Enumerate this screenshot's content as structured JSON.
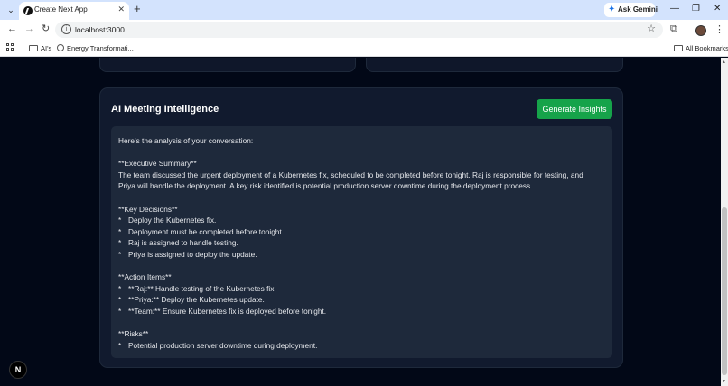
{
  "browser": {
    "tab_title": "Create Next App",
    "ask_gemini": "Ask Gemini",
    "url": "localhost:3000",
    "bookmarks": [
      "AI's",
      "Energy Transformati..."
    ],
    "all_bookmarks": "All Bookmarks"
  },
  "card": {
    "title": "AI Meeting Intelligence",
    "button_label": "Generate Insights",
    "lines": [
      "Here's the analysis of your conversation:",
      "",
      "**Executive Summary**",
      "The team discussed the urgent deployment of a Kubernetes fix, scheduled to be completed before tonight. Raj is responsible for testing, and",
      "Priya will handle the deployment. A key risk identified is potential production server downtime during the deployment process.",
      "",
      "**Key Decisions**",
      "Deploy the Kubernetes fix.",
      "Deployment must be completed before tonight.",
      "Raj is assigned to handle testing.",
      "Priya is assigned to deploy the update.",
      "",
      "**Action Items**",
      "**Raj:** Handle testing of the Kubernetes fix.",
      "**Priya:** Deploy the Kubernetes update.",
      "**Team:** Ensure Kubernetes fix is deployed before tonight.",
      "",
      "**Risks**",
      "Potential production server downtime during deployment."
    ],
    "bullet_marker": "*"
  },
  "badge": "N",
  "colors": {
    "page_bg": "#020817",
    "card_bg": "#111a2e",
    "result_bg": "#1e293b",
    "button_green": "#16a34a"
  }
}
